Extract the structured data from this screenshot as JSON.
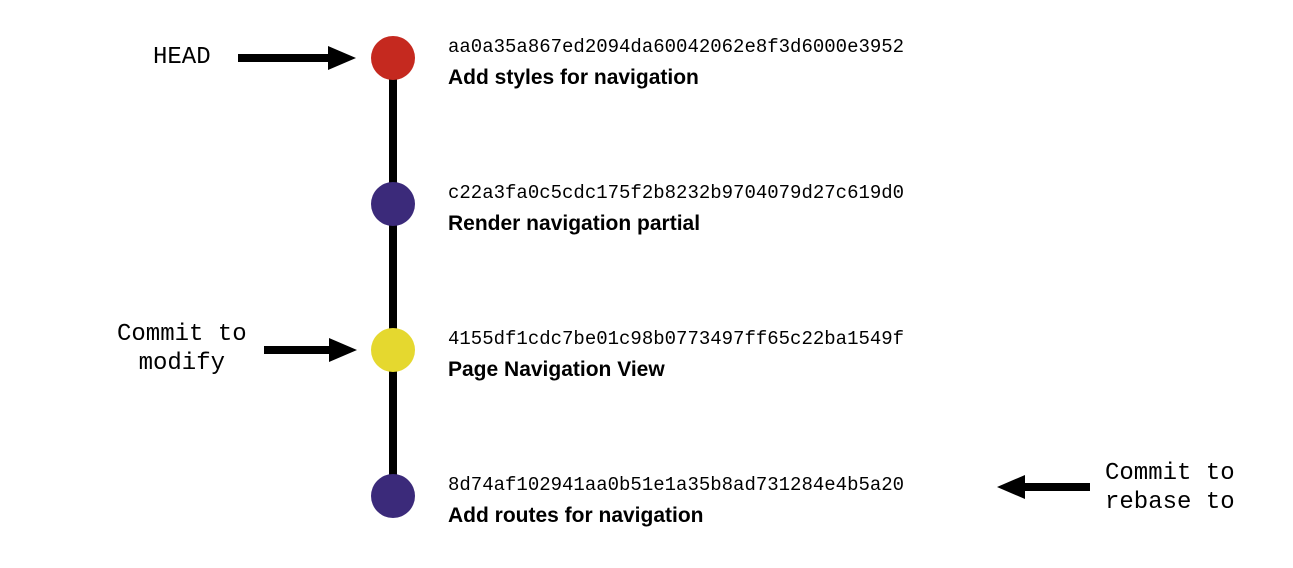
{
  "labels": {
    "head": "HEAD",
    "commit_to_modify_line1": "Commit to",
    "commit_to_modify_line2": "modify",
    "commit_to_rebase_line1": "Commit to",
    "commit_to_rebase_line2": "rebase to"
  },
  "commits": [
    {
      "hash": "aa0a35a867ed2094da60042062e8f3d6000e3952",
      "message": "Add styles for navigation",
      "color": "red"
    },
    {
      "hash": "c22a3fa0c5cdc175f2b8232b9704079d27c619d0",
      "message": "Render navigation partial",
      "color": "purple"
    },
    {
      "hash": "4155df1cdc7be01c98b0773497ff65c22ba1549f",
      "message": "Page Navigation View",
      "color": "yellow"
    },
    {
      "hash": "8d74af102941aa0b51e1a35b8ad731284e4b5a20",
      "message": "Add routes for navigation",
      "color": "purple"
    }
  ]
}
